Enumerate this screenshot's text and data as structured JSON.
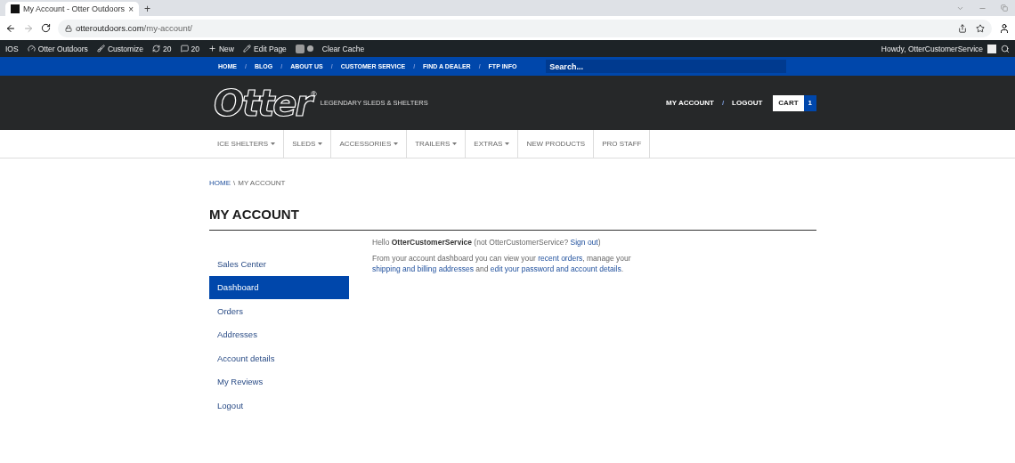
{
  "browser": {
    "tab_title": "My Account - Otter Outdoors",
    "tab_close": "×",
    "new_tab": "+",
    "url_host": "otteroutdoors.com",
    "url_path": "/my-account/"
  },
  "admin_bar": {
    "items": [
      {
        "kind": "text",
        "label": "IOS"
      },
      {
        "kind": "gauge",
        "label": "Otter Outdoors"
      },
      {
        "kind": "brush",
        "label": "Customize"
      },
      {
        "kind": "sync",
        "label": "20"
      },
      {
        "kind": "comment",
        "label": "20"
      },
      {
        "kind": "plus",
        "label": "New"
      },
      {
        "kind": "pencil",
        "label": "Edit Page"
      },
      {
        "kind": "seo"
      },
      {
        "kind": "text",
        "label": "Clear Cache"
      }
    ],
    "howdy": "Howdy, OtterCustomerService"
  },
  "top_nav": {
    "links": [
      "HOME",
      "BLOG",
      "ABOUT US",
      "CUSTOMER SERVICE",
      "FIND A DEALER",
      "FTP INFO"
    ],
    "separator": "/",
    "search_placeholder": "Search..."
  },
  "header": {
    "logo": "Otter",
    "registered": "®",
    "tagline": "LEGENDARY SLEDS & SHELTERS",
    "account_links": [
      "MY ACCOUNT",
      "LOGOUT"
    ],
    "separator": "/",
    "cart_label": "CART",
    "cart_count": "1"
  },
  "main_menu": [
    {
      "label": "ICE SHELTERS",
      "dropdown": true
    },
    {
      "label": "SLEDS",
      "dropdown": true
    },
    {
      "label": "ACCESSORIES",
      "dropdown": true
    },
    {
      "label": "TRAILERS",
      "dropdown": true
    },
    {
      "label": "EXTRAS",
      "dropdown": true
    },
    {
      "label": "NEW PRODUCTS",
      "dropdown": false
    },
    {
      "label": "PRO STAFF",
      "dropdown": false
    }
  ],
  "breadcrumb": {
    "home": "HOME",
    "separator": "\\",
    "current": "MY ACCOUNT"
  },
  "page_title": "MY ACCOUNT",
  "sidebar": {
    "items": [
      {
        "label": "Sales Center",
        "selected": false
      },
      {
        "label": "Dashboard",
        "selected": true
      },
      {
        "label": "Orders",
        "selected": false
      },
      {
        "label": "Addresses",
        "selected": false
      },
      {
        "label": "Account details",
        "selected": false
      },
      {
        "label": "My Reviews",
        "selected": false
      },
      {
        "label": "Logout",
        "selected": false
      }
    ]
  },
  "greeting": [
    {
      "kind": "text",
      "text": "Hello "
    },
    {
      "kind": "bold",
      "text": "OtterCustomerService"
    },
    {
      "kind": "text",
      "text": " (not OtterCustomerService? "
    },
    {
      "kind": "link",
      "text": "Sign out"
    },
    {
      "kind": "text",
      "text": ")"
    }
  ],
  "intro": [
    {
      "kind": "text",
      "text": "From your account dashboard you can view your "
    },
    {
      "kind": "link",
      "text": "recent orders"
    },
    {
      "kind": "text",
      "text": ", manage your "
    },
    {
      "kind": "link",
      "text": "shipping and billing addresses"
    },
    {
      "kind": "text",
      "text": " and "
    },
    {
      "kind": "link",
      "text": "edit your password and account details"
    },
    {
      "kind": "text",
      "text": "."
    }
  ]
}
